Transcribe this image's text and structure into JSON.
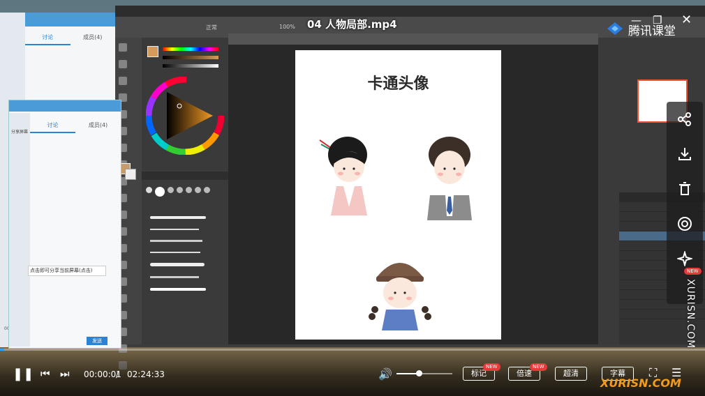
{
  "video": {
    "title": "04 人物局部.mp4",
    "brand": "腾讯课堂",
    "current_time": "00:00:01",
    "separator": "/",
    "total_time": "02:24:33",
    "progress_fraction": 0.0001,
    "volume_fraction": 0.4
  },
  "controls": {
    "mark": "标记",
    "speed": "倍速",
    "hd": "超清",
    "subtitle": "字幕",
    "new": "NEW"
  },
  "side_actions": {
    "new": "NEW"
  },
  "photoshop": {
    "canvas_title": "卡通头像",
    "option_preset": "正常",
    "option_opacity": "100%"
  },
  "chat": {
    "tab_discuss": "讨论",
    "tab_result": "成员(4)",
    "share_screen": "分享屏幕",
    "input_text": "点击即可分享当前屏幕(点击)",
    "send": "发送",
    "timer": "00:02:24"
  },
  "watermark": {
    "vertical": "XURISN.COM",
    "horizontal": "XURISN.COM"
  },
  "colors": {
    "accent_blue": "#2fa3ff",
    "badge_red": "#e5393a",
    "watermark_orange": "#f29c1f"
  }
}
